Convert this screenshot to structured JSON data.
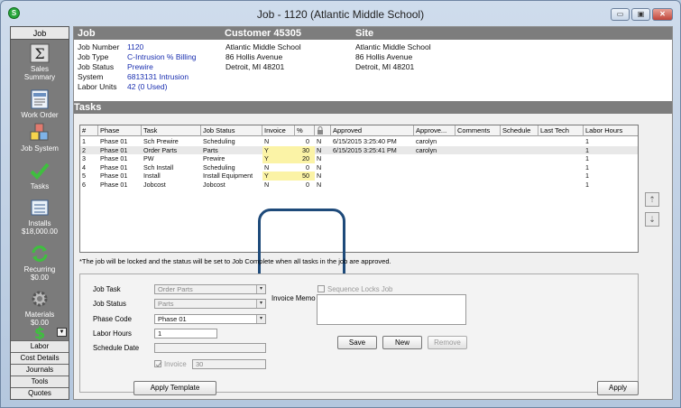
{
  "window": {
    "title": "Job - 1120 (Atlantic Middle School)",
    "icon_letter": "S",
    "controls": {
      "minimize": "▭",
      "restore": "▣",
      "close": "✕"
    }
  },
  "sidebar": {
    "header": "Job",
    "items": [
      {
        "label": "Sales",
        "label2": "Summary",
        "icon": "sigma-icon"
      },
      {
        "label": "Work Order",
        "icon": "work-order-icon"
      },
      {
        "label": "Job System",
        "icon": "abc-blocks-icon"
      },
      {
        "label": "Tasks",
        "icon": "checkmark-icon"
      },
      {
        "label": "Installs",
        "label2": "$18,000.00",
        "icon": "installs-icon"
      },
      {
        "label": "Recurring",
        "label2": "$0.00",
        "icon": "recurring-icon"
      },
      {
        "label": "Materials",
        "label2": "$0.00",
        "icon": "gear-icon"
      }
    ],
    "bottom": [
      "Labor",
      "Cost Details",
      "Journals",
      "Tools",
      "Quotes"
    ]
  },
  "header": {
    "job_heading": "Job",
    "customer_heading": "Customer 45305",
    "site_heading": "Site"
  },
  "job": {
    "number_label": "Job Number",
    "number": "1120",
    "type_label": "Job Type",
    "type": "C-Intrusion % Billing",
    "status_label": "Job Status",
    "status": "Prewire",
    "system_label": "System",
    "system": "6813131 Intrusion",
    "units_label": "Labor Units",
    "units": "42 (0 Used)"
  },
  "customer": {
    "name": "Atlantic Middle School",
    "street": "86 Hollis Avenue",
    "city": "Detroit, MI 48201"
  },
  "site": {
    "name": "Atlantic Middle School",
    "street": "86 Hollis Avenue",
    "city": "Detroit, MI 48201"
  },
  "tasks": {
    "heading": "Tasks",
    "columns": [
      "#",
      "Phase",
      "Task",
      "Job Status",
      "Invoice",
      "%",
      "",
      "Approved",
      "Approve...",
      "Comments",
      "Schedule",
      "Last Tech",
      "Labor Hours"
    ],
    "rows": [
      {
        "num": "1",
        "phase": "Phase 01",
        "task": "Sch Prewire",
        "status": "Scheduling",
        "invoice": "N",
        "pct": "0",
        "lock": "N",
        "approved": "6/15/2015 3:25:40 PM",
        "approver": "carolyn",
        "comments": "",
        "schedule": "",
        "tech": "",
        "hours": "1"
      },
      {
        "num": "2",
        "phase": "Phase 01",
        "task": "Order Parts",
        "status": "Parts",
        "invoice": "Y",
        "pct": "30",
        "lock": "N",
        "approved": "6/15/2015 3:25:41 PM",
        "approver": "carolyn",
        "comments": "",
        "schedule": "",
        "tech": "",
        "hours": "1"
      },
      {
        "num": "3",
        "phase": "Phase 01",
        "task": "PW",
        "status": "Prewire",
        "invoice": "Y",
        "pct": "20",
        "lock": "N",
        "approved": "",
        "approver": "",
        "comments": "",
        "schedule": "",
        "tech": "",
        "hours": "1"
      },
      {
        "num": "4",
        "phase": "Phase 01",
        "task": "Sch Install",
        "status": "Scheduling",
        "invoice": "N",
        "pct": "0",
        "lock": "N",
        "approved": "",
        "approver": "",
        "comments": "",
        "schedule": "",
        "tech": "",
        "hours": "1"
      },
      {
        "num": "5",
        "phase": "Phase 01",
        "task": "Install",
        "status": "Install Equipment",
        "invoice": "Y",
        "pct": "50",
        "lock": "N",
        "approved": "",
        "approver": "",
        "comments": "",
        "schedule": "",
        "tech": "",
        "hours": "1"
      },
      {
        "num": "6",
        "phase": "Phase 01",
        "task": "Jobcost",
        "status": "Jobcost",
        "invoice": "N",
        "pct": "0",
        "lock": "N",
        "approved": "",
        "approver": "",
        "comments": "",
        "schedule": "",
        "tech": "",
        "hours": "1"
      }
    ],
    "note": "*The job will be locked and the status will be set to Job Complete when all tasks in the job are approved."
  },
  "form": {
    "job_task_label": "Job Task",
    "job_task": "Order Parts",
    "job_status_label": "Job Status",
    "job_status": "Parts",
    "phase_code_label": "Phase Code",
    "phase_code": "Phase 01",
    "labor_hours_label": "Labor Hours",
    "labor_hours": "1",
    "schedule_date_label": "Schedule Date",
    "schedule_date": "",
    "invoice_label": "Invoice",
    "invoice_pct": "30",
    "invoice_memo_label": "Invoice Memo",
    "sequence_locks_label": "Sequence Locks Job",
    "save": "Save",
    "new": "New",
    "remove": "Remove"
  },
  "footer": {
    "apply_template": "Apply Template",
    "apply": "Apply"
  },
  "colors": {
    "invoice_highlight": "#fbf3a6",
    "callout": "#1e4a7a",
    "link_value": "#1a2fb0"
  }
}
